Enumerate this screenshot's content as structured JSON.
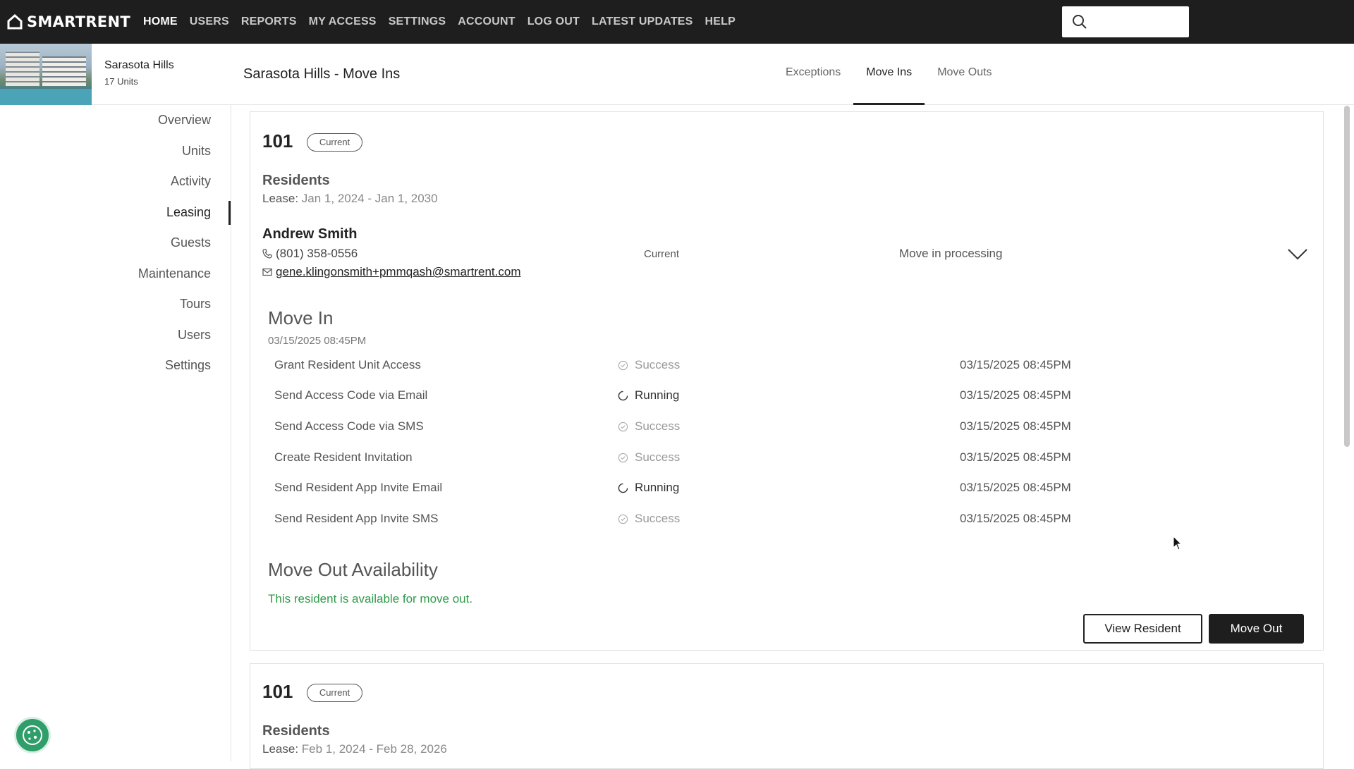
{
  "app": {
    "brand": "SMARTRENT",
    "nav": [
      "HOME",
      "USERS",
      "REPORTS",
      "MY ACCESS",
      "SETTINGS",
      "ACCOUNT",
      "LOG OUT",
      "LATEST UPDATES",
      "HELP"
    ],
    "active_nav": "HOME",
    "search_placeholder": ""
  },
  "property": {
    "name": "Sarasota Hills",
    "units": "17 Units"
  },
  "sidebar": {
    "items": [
      "Overview",
      "Units",
      "Activity",
      "Leasing",
      "Guests",
      "Maintenance",
      "Tours",
      "Users",
      "Settings"
    ],
    "active": "Leasing"
  },
  "page": {
    "title": "Sarasota Hills - Move Ins",
    "tabs": [
      "Exceptions",
      "Move Ins",
      "Move Outs"
    ],
    "active_tab": "Move Ins"
  },
  "cards": [
    {
      "unit": "101",
      "badge": "Current",
      "residents_label": "Residents",
      "lease_label": "Lease:",
      "lease_value": "Jan 1, 2024 - Jan 1, 2030",
      "resident": {
        "name": "Andrew Smith",
        "phone": "(801) 358-0556",
        "email": "gene.klingonsmith+pmmqash@smartrent.com",
        "status": "Current",
        "process": "Move in processing"
      },
      "move_in_title": "Move In",
      "move_in_date": "03/15/2025 08:45PM",
      "steps": [
        {
          "name": "Grant Resident Unit Access",
          "status": "Success",
          "time": "03/15/2025 08:45PM"
        },
        {
          "name": "Send Access Code via Email",
          "status": "Running",
          "time": "03/15/2025 08:45PM"
        },
        {
          "name": "Send Access Code via SMS",
          "status": "Success",
          "time": "03/15/2025 08:45PM"
        },
        {
          "name": "Create Resident Invitation",
          "status": "Success",
          "time": "03/15/2025 08:45PM"
        },
        {
          "name": "Send Resident App Invite Email",
          "status": "Running",
          "time": "03/15/2025 08:45PM"
        },
        {
          "name": "Send Resident App Invite SMS",
          "status": "Success",
          "time": "03/15/2025 08:45PM"
        }
      ],
      "move_out_title": "Move Out Availability",
      "move_out_text": "This resident is available for move out.",
      "view_button": "View Resident",
      "move_out_button": "Move Out"
    },
    {
      "unit": "101",
      "badge": "Current",
      "residents_label": "Residents",
      "lease_label": "Lease:",
      "lease_value": "Feb 1, 2024 - Feb 28, 2026"
    }
  ],
  "colors": {
    "topbar": "#1e1e1e",
    "success_text": "#2f9a4a",
    "cookie": "#2f9e6a"
  }
}
